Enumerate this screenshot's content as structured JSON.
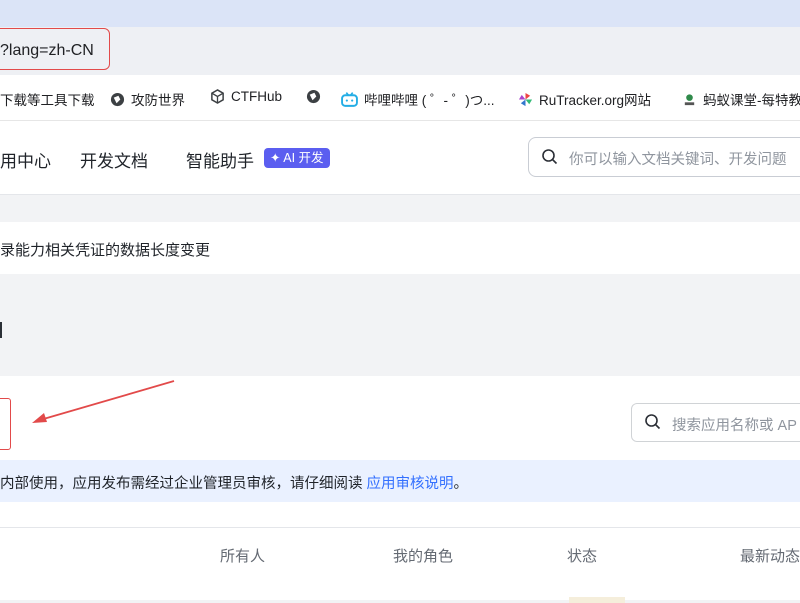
{
  "browser": {
    "url_fragment": "?lang=zh-CN",
    "bookmarks": [
      {
        "label": "下载等工具下载",
        "icon": "none"
      },
      {
        "label": "攻防世界",
        "icon": "globe-icon"
      },
      {
        "label": "CTFHub",
        "icon": "cube-icon"
      },
      {
        "label": "",
        "icon": "globe-icon"
      },
      {
        "label": "哔哩哔哩 ( ゜- ゜)つ...",
        "icon": "bilibili-icon"
      },
      {
        "label": "RuTracker.org网站",
        "icon": "pinwheel-icon"
      },
      {
        "label": "蚂蚁课堂-每特教",
        "icon": "ant-icon"
      }
    ]
  },
  "topnav": {
    "items": [
      "用中心",
      "开发文档",
      "智能助手"
    ],
    "ai_badge": "✦ AI 开发",
    "search_placeholder": "你可以输入文档关键词、开发问题"
  },
  "notice": {
    "text": "录能力相关凭证的数据长度变更"
  },
  "app_list": {
    "search_placeholder": "搜索应用名称或 AP",
    "tip_text": "内部使用，应用发布需经过企业管理员审核，请仔细阅读 ",
    "tip_link": "应用审核说明",
    "tip_end": "。",
    "columns": [
      "所有人",
      "我的角色",
      "状态",
      "最新动态"
    ]
  },
  "colors": {
    "accent": "#3370ff",
    "ai_badge": "#5b5ef0",
    "annotation_red": "#e24a4a"
  }
}
